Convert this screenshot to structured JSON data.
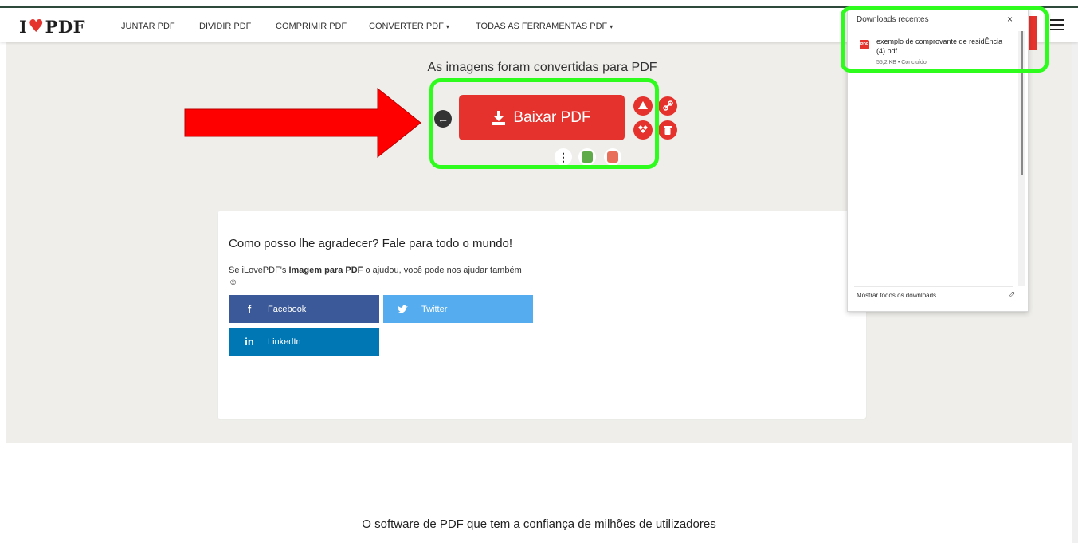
{
  "header": {
    "logo_left": "I",
    "logo_right": "PDF",
    "nav": [
      {
        "label": "JUNTAR PDF",
        "dropdown": false
      },
      {
        "label": "DIVIDIR PDF",
        "dropdown": false
      },
      {
        "label": "COMPRIMIR PDF",
        "dropdown": false
      },
      {
        "label": "CONVERTER PDF",
        "dropdown": true
      },
      {
        "label": "TODAS AS FERRAMENTAS PDF",
        "dropdown": true
      }
    ],
    "caret": "▾"
  },
  "result": {
    "title": "As imagens foram convertidas para PDF",
    "download_label": "Baixar PDF"
  },
  "share_card": {
    "heading": "Como posso lhe agradecer? Fale para todo o mundo!",
    "text_prefix": "Se iLovePDF's ",
    "text_bold": "Imagem para PDF",
    "text_suffix": " o ajudou, você pode nos ajudar também",
    "emoji": "☺",
    "buttons": {
      "facebook": "Facebook",
      "twitter": "Twitter",
      "linkedin": "LinkedIn"
    }
  },
  "footer": {
    "title": "O software de PDF que tem a confiança de milhões de utilizadores"
  },
  "downloads_popup": {
    "header": "Downloads recentes",
    "close": "×",
    "item": {
      "icon_label": "PDF",
      "filename": "exemplo de comprovante de residÊncia (4).pdf",
      "meta": "55,2 KB • Concluído"
    },
    "show_all": "Mostrar todos os downloads"
  },
  "colors": {
    "brand_red": "#e5322d",
    "highlight_green": "#2efc1d",
    "annotation_arrow_red": "#ff0000",
    "facebook": "#3b5998",
    "twitter": "#55acee",
    "linkedin": "#0077b5"
  },
  "icons": [
    "heart-logo-icon",
    "download-icon",
    "back-arrow-icon",
    "google-drive-icon",
    "link-icon",
    "dropbox-icon",
    "trash-icon",
    "more-options-icon",
    "excel-icon",
    "translate-icon",
    "facebook-icon",
    "twitter-icon",
    "linkedin-icon",
    "pdf-file-icon",
    "close-icon",
    "open-external-icon",
    "hamburger-menu-icon"
  ]
}
